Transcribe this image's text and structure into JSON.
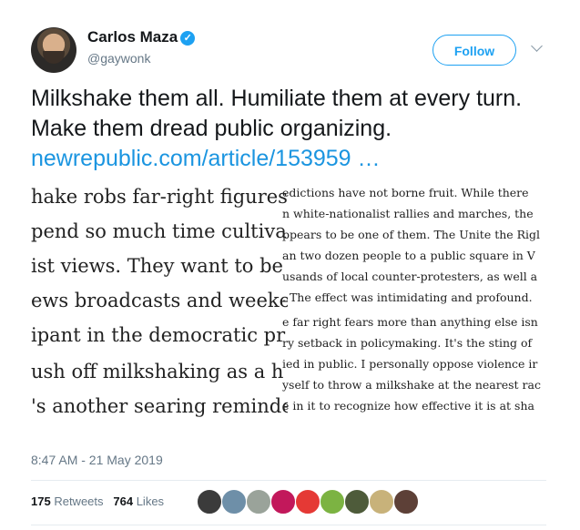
{
  "author": {
    "name": "Carlos Maza",
    "handle": "@gaywonk",
    "verified_icon": "verified-badge-icon"
  },
  "follow_label": "Follow",
  "tweet": {
    "text": "Milkshake them all. Humiliate them at every turn. Make them dread public organizing.",
    "link": "newrepublic.com/article/153959 …"
  },
  "photo": {
    "big_lines": [
      "hake robs far-right figures",
      "pend so much time cultiva",
      "ist views. They want to be",
      "ews broadcasts and weeke",
      "ipant in the democratic pr",
      "ush off milkshaking as a h",
      "'s another searing reminde"
    ],
    "small_lines": [
      "edictions have not borne fruit. While there",
      "n white-nationalist rallies and marches, the",
      "ppears to be one of them. The Unite the Rigl",
      "an two dozen people to a public square in V",
      "usands of local counter-protesters, as well a",
      ". The effect was intimidating and profound.",
      "e far right fears more than anything else isn",
      "ry setback in policymaking. It's the sting of",
      "ied in public. I personally oppose violence ir",
      "yself to throw a milkshake at the nearest rac",
      "e in it to recognize how effective it is at sha"
    ]
  },
  "timestamp": "8:47 AM - 21 May 2019",
  "stats": {
    "retweets_count": "175",
    "retweets_label": "Retweets",
    "likes_count": "764",
    "likes_label": "Likes"
  },
  "likers": [
    {
      "icon": "liker-avatar-icon",
      "color": "#3b3b3b"
    },
    {
      "icon": "liker-avatar-icon",
      "color": "#6e8fa8"
    },
    {
      "icon": "liker-avatar-icon",
      "color": "#9aa39a"
    },
    {
      "icon": "liker-avatar-icon",
      "color": "#c2185b"
    },
    {
      "icon": "liker-avatar-icon",
      "color": "#e53935"
    },
    {
      "icon": "liker-avatar-icon",
      "color": "#7cb342"
    },
    {
      "icon": "liker-avatar-icon",
      "color": "#4e5b3a"
    },
    {
      "icon": "liker-avatar-icon",
      "color": "#c8b27a"
    },
    {
      "icon": "liker-avatar-icon",
      "color": "#5d4037"
    }
  ],
  "colors": {
    "accent": "#1da1f2",
    "link": "#1b95e0",
    "muted": "#657786"
  }
}
